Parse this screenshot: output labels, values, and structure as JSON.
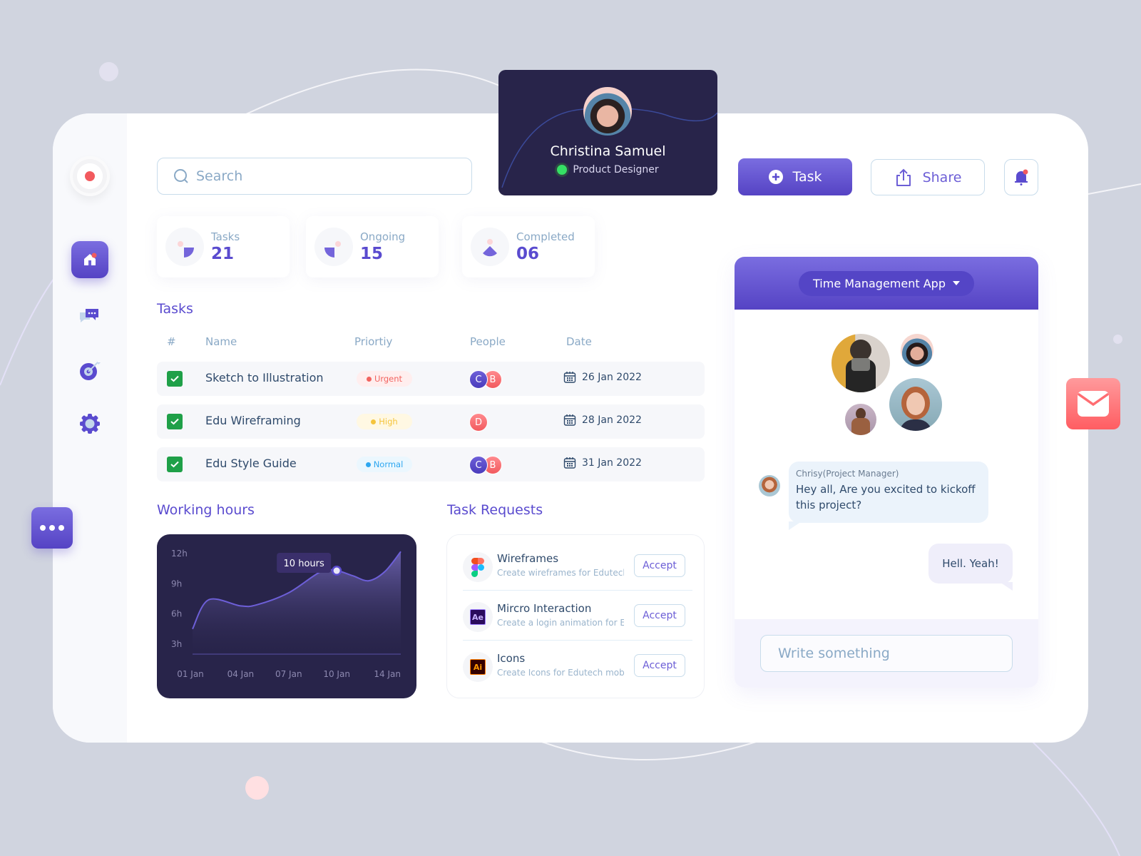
{
  "colors": {
    "accent": "#5a4bcf",
    "accent_gradient_top": "#7a6de0",
    "accent_gradient_bottom": "#5543c4",
    "dark_card": "#28244a",
    "background": "#d0d4df",
    "urgent": "#f2635f",
    "high": "#f5c43c",
    "normal": "#2ea7f0",
    "success": "#1fa048",
    "online": "#35e065"
  },
  "sidebar": {
    "items": [
      {
        "icon": "home-icon",
        "active": true,
        "badge": true
      },
      {
        "icon": "chat-icon",
        "active": false
      },
      {
        "icon": "target-icon",
        "active": false
      },
      {
        "icon": "gear-icon",
        "active": false
      }
    ]
  },
  "search": {
    "placeholder": "Search"
  },
  "profile": {
    "name": "Christina Samuel",
    "role": "Product Designer",
    "status": "online"
  },
  "toolbar": {
    "task_label": "Task",
    "share_label": "Share"
  },
  "stats": [
    {
      "label": "Tasks",
      "value": "21"
    },
    {
      "label": "Ongoing",
      "value": "15"
    },
    {
      "label": "Completed",
      "value": "06"
    }
  ],
  "tasks": {
    "title": "Tasks",
    "columns": [
      "#",
      "Name",
      "Priortiy",
      "People",
      "Date"
    ],
    "rows": [
      {
        "done": true,
        "name": "Sketch to Illustration",
        "priority": "Urgent",
        "people": [
          "C",
          "B"
        ],
        "date": "26 Jan 2022"
      },
      {
        "done": true,
        "name": "Edu Wireframing",
        "priority": "High",
        "people": [
          "D"
        ],
        "date": "28 Jan 2022"
      },
      {
        "done": true,
        "name": "Edu Style Guide",
        "priority": "Normal",
        "people": [
          "C",
          "B"
        ],
        "date": "31 Jan 2022"
      }
    ]
  },
  "working_hours": {
    "title": "Working hours",
    "tooltip": "10 hours"
  },
  "chart_data": {
    "type": "area",
    "title": "Working hours",
    "xlabel": "",
    "ylabel": "",
    "x_ticks": [
      "01 Jan",
      "04 Jan",
      "07 Jan",
      "10 Jan",
      "14 Jan"
    ],
    "y_ticks": [
      "3h",
      "6h",
      "9h",
      "12h"
    ],
    "ylim": [
      2,
      12.5
    ],
    "grid": false,
    "series": [
      {
        "name": "Hours",
        "x": [
          1,
          2,
          4,
          5,
          7,
          9,
          10,
          11,
          12,
          13,
          14
        ],
        "values": [
          4.5,
          7.4,
          6.8,
          6.9,
          8.1,
          10.2,
          10.3,
          9.8,
          9.3,
          10.2,
          12.2
        ]
      }
    ],
    "highlight": {
      "x": 10,
      "value": 10,
      "label": "10 hours"
    }
  },
  "task_requests": {
    "title": "Task Requests",
    "accept_label": "Accept",
    "items": [
      {
        "icon": "figma-icon",
        "title": "Wireframes",
        "subtitle": "Create wireframes for Edutech"
      },
      {
        "icon": "after-effects-icon",
        "icon_text": "Ae",
        "title": "Mircro Interaction",
        "subtitle": "Create a login animation for Edu.."
      },
      {
        "icon": "illustrator-icon",
        "icon_text": "Ai",
        "title": "Icons",
        "subtitle": "Create Icons for Edutech mobile.."
      }
    ]
  },
  "chat": {
    "project": "Time Management App",
    "messages": [
      {
        "sender": "Chrisy(Project Manager)",
        "text": "Hey all, Are you excited to kickoff this project?",
        "incoming": true
      },
      {
        "text": "Hell. Yeah!",
        "incoming": false
      }
    ],
    "input_placeholder": "Write something"
  }
}
